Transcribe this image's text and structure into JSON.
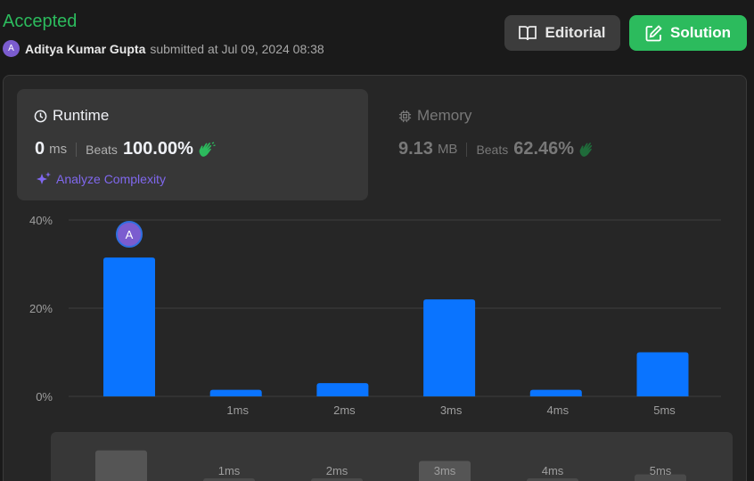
{
  "header": {
    "status": "Accepted",
    "avatar_letter": "A",
    "user_name": "Aditya Kumar Gupta",
    "submitted_text": "submitted at Jul 09, 2024 08:38",
    "editorial_label": "Editorial",
    "solution_label": "Solution"
  },
  "runtime": {
    "title": "Runtime",
    "value": "0",
    "unit": "ms",
    "beats_label": "Beats",
    "beats_value": "100.00%",
    "analyze_label": "Analyze Complexity"
  },
  "memory": {
    "title": "Memory",
    "value": "9.13",
    "unit": "MB",
    "beats_label": "Beats",
    "beats_value": "62.46%"
  },
  "chart_data": {
    "type": "bar",
    "categories": [
      "",
      "1ms",
      "2ms",
      "3ms",
      "4ms",
      "5ms"
    ],
    "values": [
      31.5,
      1.5,
      3,
      22,
      1.5,
      10
    ],
    "y_ticks": [
      "0%",
      "20%",
      "40%"
    ],
    "ylim": [
      0,
      40
    ],
    "marker_label": "A",
    "marker_index": 0,
    "bar_color": "#0a74ff",
    "grid": true
  },
  "mini_chart": {
    "labels": [
      "",
      "1ms",
      "2ms",
      "3ms",
      "4ms",
      "5ms"
    ],
    "highlight_index": 3
  }
}
